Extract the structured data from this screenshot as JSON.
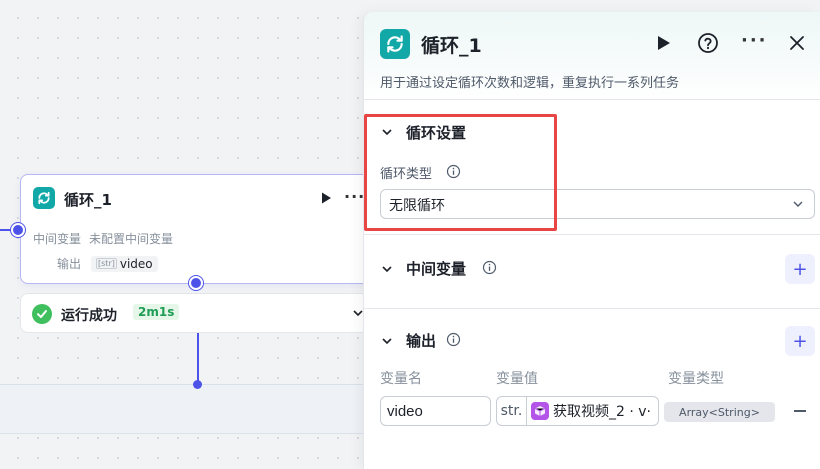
{
  "canvas": {
    "node": {
      "title": "循环_1",
      "row1_label": "中间变量",
      "row1_value": "未配置中间变量",
      "row2_label": "输出",
      "row2_tag_icon": "[str]",
      "row2_value": "video"
    },
    "status": {
      "text": "运行成功",
      "time": "2m1s"
    }
  },
  "panel": {
    "title": "循环_1",
    "description": "用于通过设定循环次数和逻辑，重复执行一系列任务",
    "loop_settings": {
      "title": "循环设置",
      "type_label": "循环类型",
      "type_value": "无限循环"
    },
    "intermediate": {
      "title": "中间变量",
      "add_label": "+"
    },
    "output": {
      "title": "输出",
      "add_label": "+",
      "columns": [
        "变量名",
        "变量值",
        "变量类型"
      ],
      "row": {
        "name": "video",
        "value_prefix": "str.",
        "value_ref": "获取视频_2 · v·",
        "type": "Array<String>"
      }
    }
  },
  "colors": {
    "accent": "#4d53e8",
    "node_icon": "#13a8a8",
    "success": "#3fbf5e",
    "highlight": "#e84545"
  }
}
